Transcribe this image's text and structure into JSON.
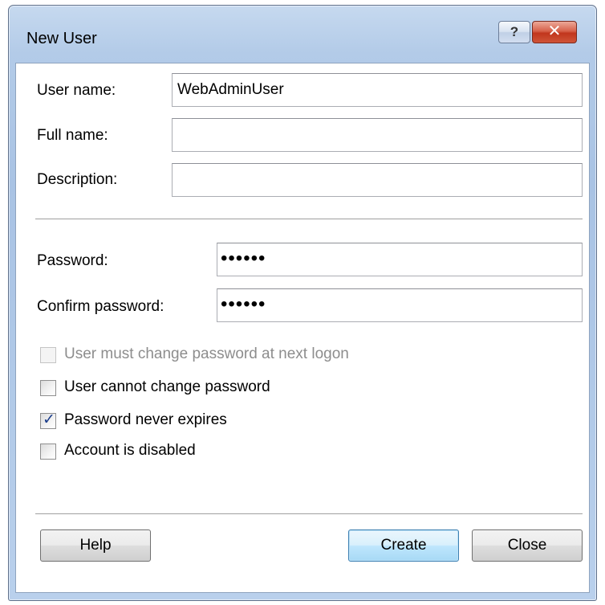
{
  "window": {
    "title": "New User",
    "help_glyph": "?",
    "close_glyph": "✕"
  },
  "fields": {
    "user_name_label": "User name:",
    "user_name_value": "WebAdminUser",
    "full_name_label": "Full name:",
    "full_name_value": "",
    "description_label": "Description:",
    "description_value": "",
    "password_label": "Password:",
    "password_value": "••••••",
    "confirm_label": "Confirm password:",
    "confirm_value": "••••••"
  },
  "options": [
    {
      "label": "User must change password at next logon",
      "checked": false,
      "enabled": false
    },
    {
      "label": "User cannot change password",
      "checked": false,
      "enabled": true
    },
    {
      "label": "Password never expires",
      "checked": true,
      "enabled": true
    },
    {
      "label": "Account is disabled",
      "checked": false,
      "enabled": true
    }
  ],
  "buttons": {
    "help": "Help",
    "create": "Create",
    "close": "Close"
  },
  "colors": {
    "title_bar": "#b3cbe8",
    "close_button": "#c1361d",
    "default_button": "#bee6fd"
  }
}
